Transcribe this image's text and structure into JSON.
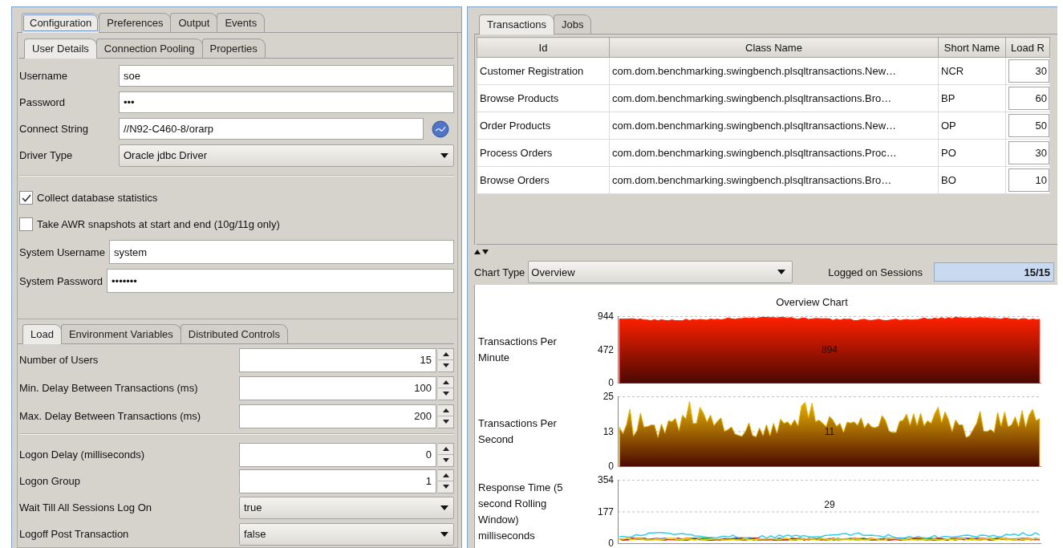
{
  "left_panel": {
    "main_tabs": [
      {
        "label": "Configuration",
        "selected": true
      },
      {
        "label": "Preferences",
        "selected": false
      },
      {
        "label": "Output",
        "selected": false
      },
      {
        "label": "Events",
        "selected": false
      }
    ],
    "sub_tabs": [
      {
        "label": "User Details",
        "selected": true
      },
      {
        "label": "Connection Pooling",
        "selected": false
      },
      {
        "label": "Properties",
        "selected": false
      }
    ],
    "user_fields": [
      {
        "kind": "text",
        "label": "Username",
        "value": "soe"
      },
      {
        "kind": "text",
        "label": "Password",
        "value": "•••"
      },
      {
        "kind": "text_with_button",
        "label": "Connect String",
        "value": "//N92-C460-8/orarp"
      },
      {
        "kind": "dropdown",
        "label": "Driver Type",
        "value": "Oracle jdbc Driver"
      }
    ],
    "options": [
      {
        "label": "Collect database statistics",
        "checked": true
      },
      {
        "label": "Take AWR snapshots at start and end (10g/11g only)",
        "checked": false
      }
    ],
    "system_fields": [
      {
        "kind": "text",
        "label": "System Username",
        "value": "system"
      },
      {
        "kind": "text",
        "label": "System Password",
        "value": "•••••••"
      }
    ],
    "load_tabs": [
      {
        "label": "Load",
        "selected": true
      },
      {
        "label": "Environment Variables",
        "selected": false
      },
      {
        "label": "Distributed Controls",
        "selected": false
      }
    ],
    "load_fields": [
      {
        "kind": "spinner",
        "label": "Number of Users",
        "value": "15"
      },
      {
        "kind": "spinner",
        "label": "Min. Delay Between Transactions (ms)",
        "value": "100"
      },
      {
        "kind": "spinner",
        "label": "Max. Delay Between Transactions (ms)",
        "value": "200"
      }
    ],
    "logon_fields": [
      {
        "kind": "spinner",
        "label": "Logon Delay (milliseconds)",
        "value": "0"
      },
      {
        "kind": "spinner",
        "label": "Logon Group",
        "value": "1"
      },
      {
        "kind": "dropdown",
        "label": "Wait Till All Sessions Log On",
        "value": "true"
      },
      {
        "kind": "dropdown",
        "label": "Logoff Post Transaction",
        "value": "false"
      }
    ]
  },
  "right_panel": {
    "tabs": [
      {
        "label": "Transactions",
        "selected": true
      },
      {
        "label": "Jobs",
        "selected": false
      }
    ],
    "table": {
      "columns": [
        "Id",
        "Class Name",
        "Short Name",
        "Load R"
      ],
      "rows": [
        [
          "Customer Registration",
          "com.dom.benchmarking.swingbench.plsqltransactions.New…",
          "NCR",
          "30"
        ],
        [
          "Browse Products",
          "com.dom.benchmarking.swingbench.plsqltransactions.Bro…",
          "BP",
          "60"
        ],
        [
          "Order Products",
          "com.dom.benchmarking.swingbench.plsqltransactions.New…",
          "OP",
          "50"
        ],
        [
          "Process Orders",
          "com.dom.benchmarking.swingbench.plsqltransactions.Proc…",
          "PO",
          "30"
        ],
        [
          "Browse Orders",
          "com.dom.benchmarking.swingbench.plsqltransactions.Bro…",
          "BO",
          "10"
        ]
      ]
    },
    "chart_type": {
      "label": "Chart Type",
      "value": "Overview"
    },
    "sessions": {
      "label": "Logged on Sessions",
      "value": "15/15"
    },
    "chart": {
      "title": "Overview Chart",
      "panels": [
        {
          "kind": "area",
          "label": "Transactions Per Minute",
          "ticks": [
            "944",
            "472",
            "0"
          ],
          "current": "894",
          "color": "#ff2000"
        },
        {
          "kind": "area",
          "label": "Transactions Per Second",
          "ticks": [
            "25",
            "13",
            "0"
          ],
          "current": "11",
          "color": "#e8b400"
        },
        {
          "kind": "lines",
          "label": "Response Time (5 second Rolling Window)",
          "unit": "milliseconds",
          "ticks": [
            "354",
            "177",
            "0"
          ],
          "current": "29"
        }
      ]
    }
  }
}
